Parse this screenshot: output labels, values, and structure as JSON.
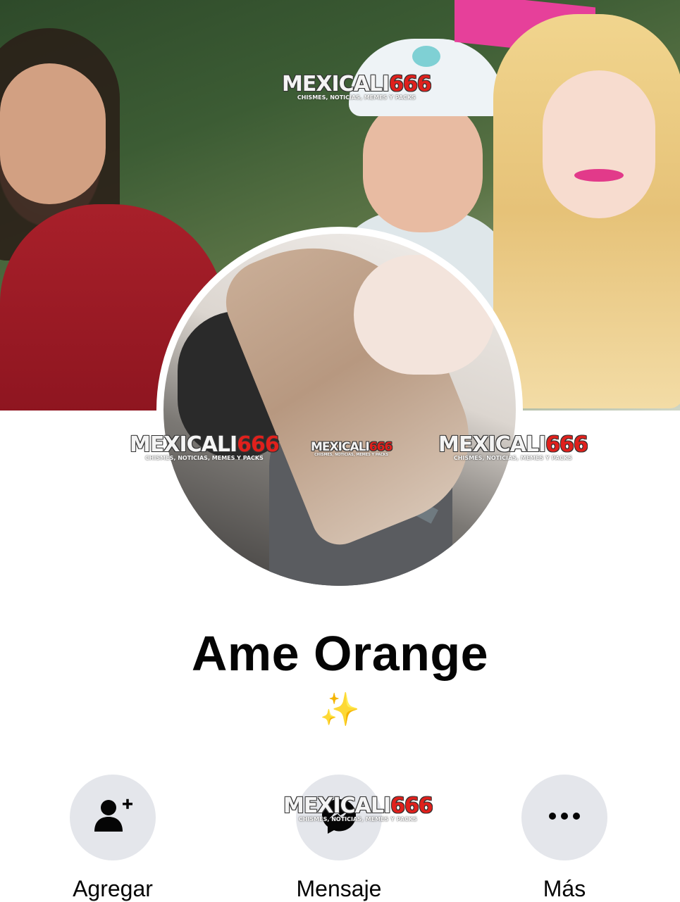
{
  "profile": {
    "name": "Ame Orange",
    "bio": "✨"
  },
  "watermark": {
    "brand_text": "MEXICALI",
    "brand_number": "666",
    "tagline": "CHISMES, NOTICIAS, MEMES Y PACKS"
  },
  "actions": {
    "add_label": "Agregar",
    "message_label": "Mensaje",
    "more_label": "Más"
  },
  "icons": {
    "add": "add-friend-icon",
    "message": "messenger-icon",
    "more": "more-dots-icon"
  },
  "colors": {
    "text": "#050505",
    "button_bg": "#e4e6eb",
    "watermark_red": "#e0201c",
    "sparkle": "#f2c40f"
  }
}
